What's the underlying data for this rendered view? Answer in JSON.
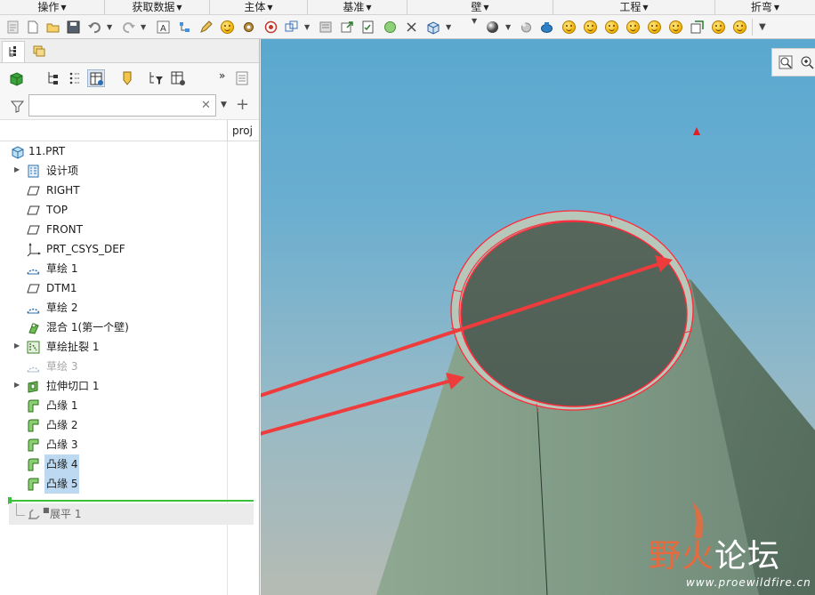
{
  "ribbon": {
    "groups": [
      {
        "label": "操作"
      },
      {
        "label": "获取数据"
      },
      {
        "label": "主体"
      },
      {
        "label": "基准"
      },
      {
        "label": "壁"
      },
      {
        "label": "工程"
      },
      {
        "label": "折弯"
      }
    ]
  },
  "panel": {
    "column_header": "proj",
    "search": {
      "value": "",
      "placeholder": ""
    },
    "tools_more": "»"
  },
  "tree": {
    "root": {
      "label": "11.PRT",
      "icon": "part-icon"
    },
    "items": [
      {
        "label": "设计项",
        "icon": "design-items-icon",
        "expandable": true
      },
      {
        "label": "RIGHT",
        "icon": "datum-plane-icon"
      },
      {
        "label": "TOP",
        "icon": "datum-plane-icon"
      },
      {
        "label": "FRONT",
        "icon": "datum-plane-icon"
      },
      {
        "label": "PRT_CSYS_DEF",
        "icon": "coordinate-system-icon"
      },
      {
        "label": "草绘 1",
        "icon": "sketch-icon"
      },
      {
        "label": "DTM1",
        "icon": "datum-plane-icon"
      },
      {
        "label": "草绘 2",
        "icon": "sketch-icon"
      },
      {
        "label": "混合 1(第一个壁)",
        "icon": "blend-wall-icon"
      },
      {
        "label": "草绘扯裂 1",
        "icon": "sketched-rip-icon",
        "expandable": true
      },
      {
        "label": "草绘 3",
        "icon": "sketch-icon",
        "dimmed": true
      },
      {
        "label": "拉伸切口 1",
        "icon": "extrude-cut-icon",
        "expandable": true
      },
      {
        "label": "凸缘 1",
        "icon": "flange-icon"
      },
      {
        "label": "凸缘 2",
        "icon": "flange-icon"
      },
      {
        "label": "凸缘 3",
        "icon": "flange-icon"
      },
      {
        "label": "凸缘 4",
        "icon": "flange-icon",
        "selected": true
      },
      {
        "label": "凸缘 5",
        "icon": "flange-icon",
        "selected": true
      }
    ],
    "suppressed": {
      "label": "展平 1",
      "icon": "unbend-icon"
    }
  },
  "watermark": {
    "brand_part1": "野火",
    "brand_part2": "论坛",
    "url": "www.proewildfire.cn"
  },
  "colors": {
    "selection": "#bcd9f1",
    "insert_marker": "#3cc13c",
    "highlight_edge": "#ff2a3a",
    "arrow": "#ee3b3b",
    "watermark_accent": "#e66a3e"
  }
}
